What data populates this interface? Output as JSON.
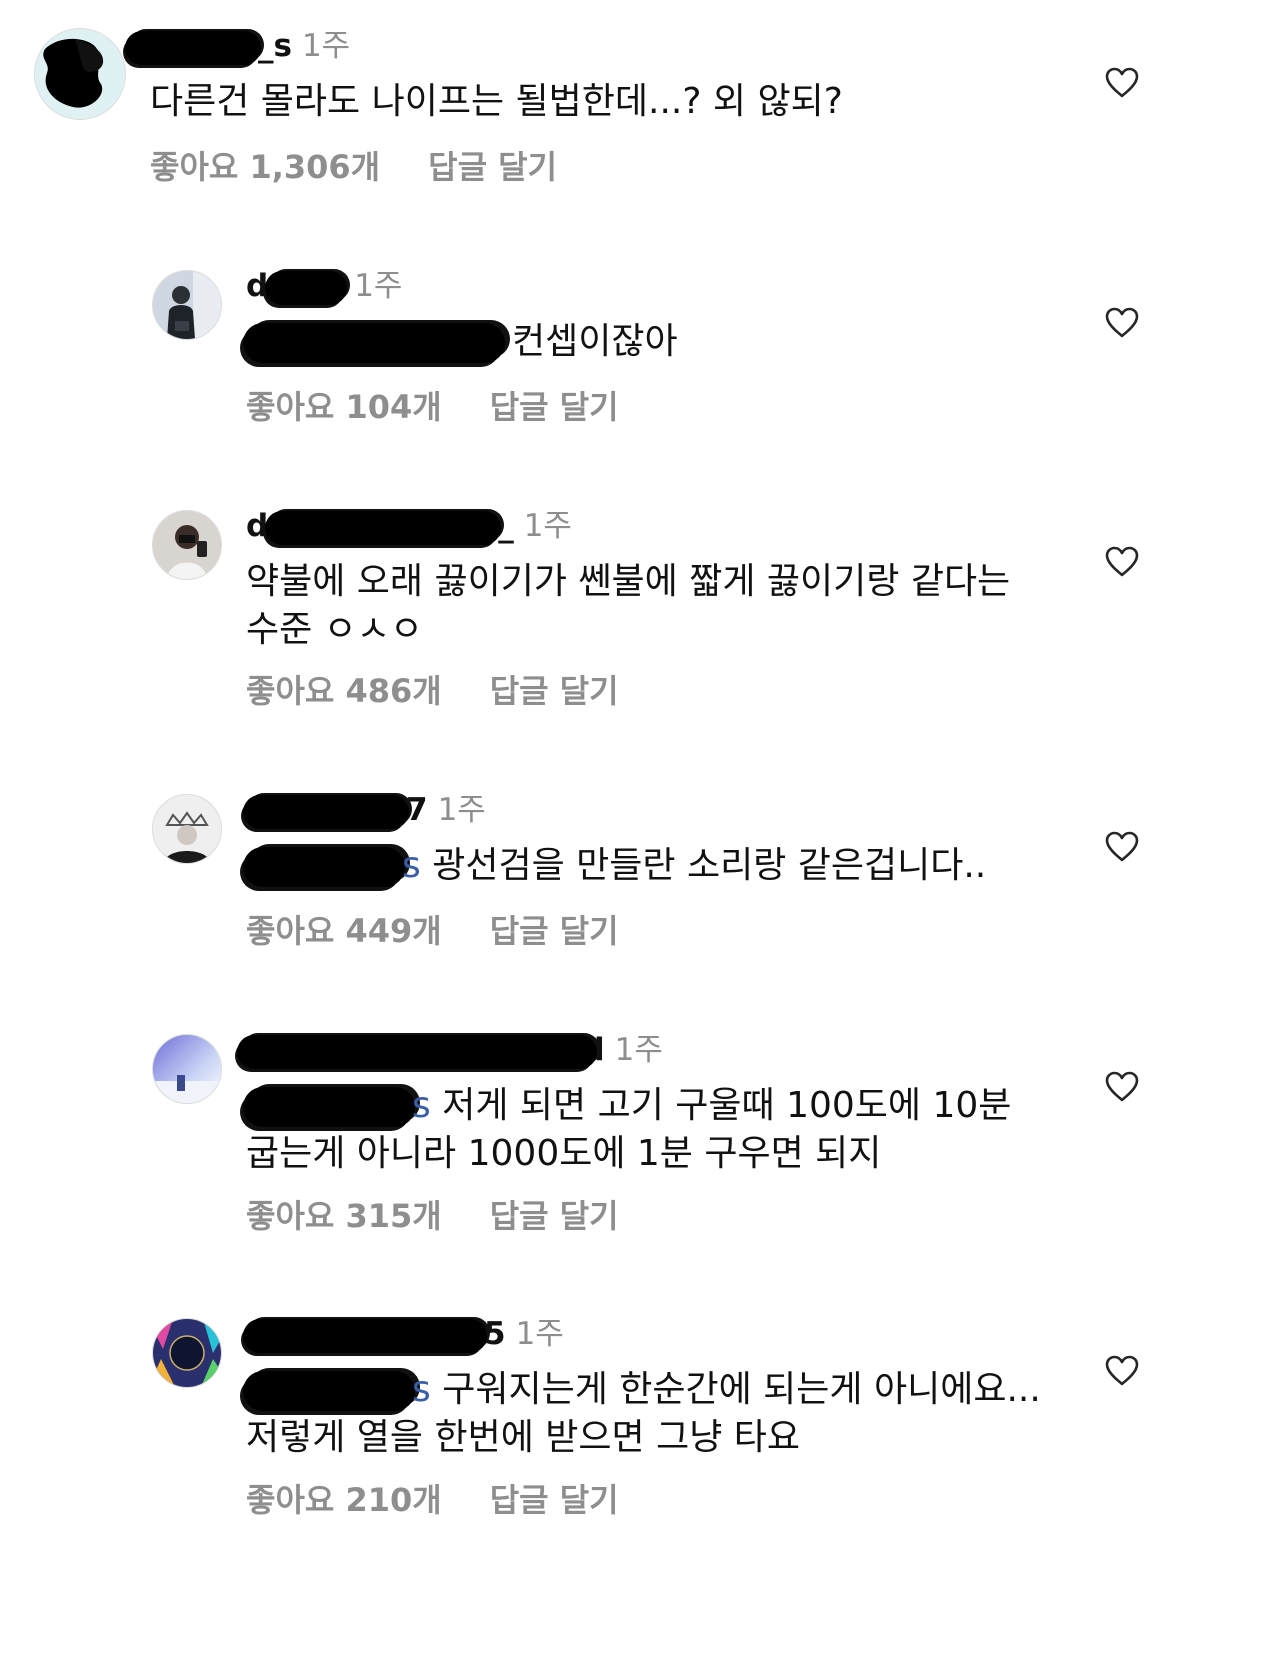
{
  "comments": [
    {
      "username_visible": "_s",
      "time": "1주",
      "text": "다른건 몰라도 나이프는 될법한데...? 외 않되?",
      "mention_tail": "",
      "likes": "좋아요 1,306개",
      "reply": "답글 달기",
      "avatar": "redacted-avatar"
    },
    {
      "username_visible": "d",
      "time": "1주",
      "text": "컨셉이잖아",
      "mention_tail": "",
      "likes": "좋아요 104개",
      "reply": "답글 달기",
      "avatar": "person-photo"
    },
    {
      "username_visible": "d",
      "username_tail": "_",
      "time": "1주",
      "text": "약불에 오래 끓이기가 쎈불에 짧게 끓이기랑 같다는 수준 ㅇㅅㅇ",
      "mention_tail": "",
      "likes": "좋아요 486개",
      "reply": "답글 달기",
      "avatar": "selfie-photo"
    },
    {
      "username_visible": "7",
      "time": "1주",
      "text": "광선검을 만들란 소리랑 같은겁니다..",
      "mention_tail": "s",
      "likes": "좋아요 449개",
      "reply": "답글 달기",
      "avatar": "tiara-photo"
    },
    {
      "username_visible": "l",
      "time": "1주",
      "text": "저게 되면 고기 구울때 100도에 10분 굽는게 아니라 1000도에 1분 구우면 되지",
      "mention_tail": "s",
      "likes": "좋아요 315개",
      "reply": "답글 달기",
      "avatar": "sky-photo"
    },
    {
      "username_visible": "5",
      "time": "1주",
      "text": "구워지는게 한순간에 되는게 아니에요... 저렇게 열을 한번에 받으면 그냥 타요",
      "mention_tail": "s",
      "likes": "좋아요 210개",
      "reply": "답글 달기",
      "avatar": "the-last-concept-logo"
    }
  ],
  "icons": {
    "like": "heart-outline-icon"
  },
  "colors": {
    "secondary_text": "#8e8e8e",
    "primary_text": "#111111",
    "mention": "#3b5ea8"
  }
}
